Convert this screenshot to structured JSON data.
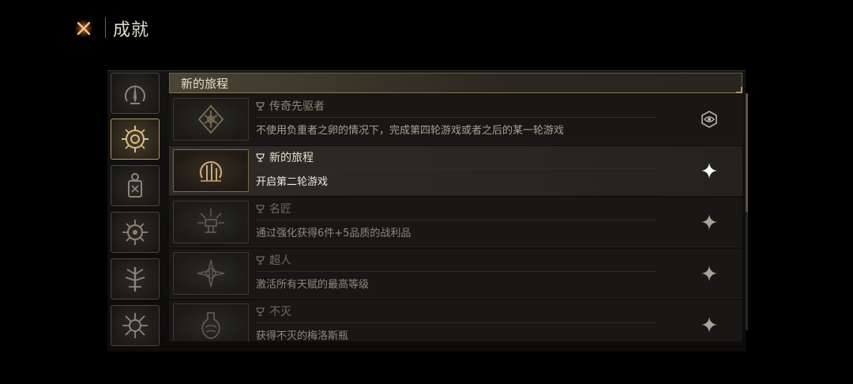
{
  "header": {
    "title": "成就"
  },
  "category": {
    "title": "新的旅程"
  },
  "sidebar": {
    "categories": [
      {
        "icon": "spire-icon"
      },
      {
        "icon": "compass-icon"
      },
      {
        "icon": "lantern-icon"
      },
      {
        "icon": "sun-eye-icon"
      },
      {
        "icon": "tree-icon"
      },
      {
        "icon": "thorn-icon"
      }
    ],
    "active_index": 1
  },
  "achievements": [
    {
      "name": "传奇先驱者",
      "desc": "不使用负重者之卵的情况下，完成第四轮游戏或者之后的某一轮游戏",
      "icon": "rune-emblem-icon",
      "status_icon": "eye-badge-icon",
      "state": "normal"
    },
    {
      "name": "新的旅程",
      "desc": "开启第二轮游戏",
      "icon": "ring-blade-icon",
      "status_icon": "sparkle-icon",
      "state": "active"
    },
    {
      "name": "名匠",
      "desc": "通过强化获得6件+5品质的战利品",
      "icon": "anvil-icon",
      "status_icon": "sparkle-icon",
      "state": "dim"
    },
    {
      "name": "超人",
      "desc": "激活所有天赋的最高等级",
      "icon": "star-sigil-icon",
      "status_icon": "sparkle-icon",
      "state": "dim"
    },
    {
      "name": "不灭",
      "desc": "获得不灭的梅洛斯瓶",
      "icon": "flask-icon",
      "status_icon": "sparkle-icon",
      "state": "dim"
    }
  ],
  "colors": {
    "accent": "#b49a62",
    "background": "#000000",
    "panel": "#181715",
    "text": "#c9c2b2"
  }
}
